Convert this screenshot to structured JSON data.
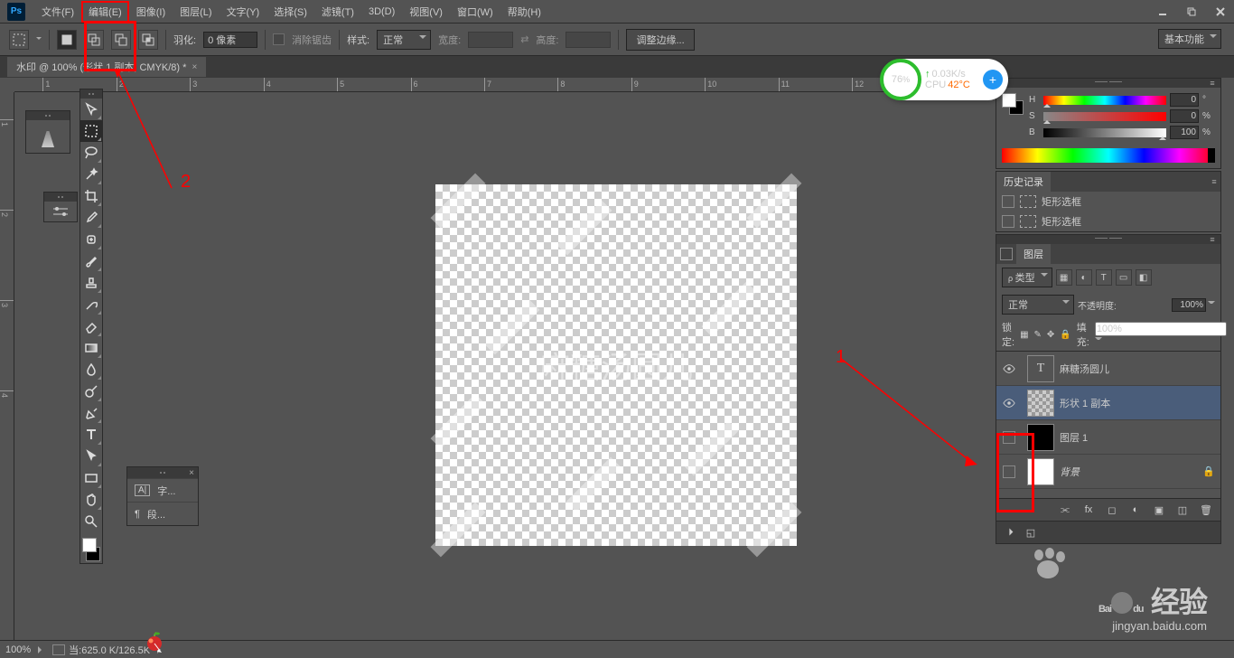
{
  "menu": {
    "items": [
      "文件(F)",
      "编辑(E)",
      "图像(I)",
      "图层(L)",
      "文字(Y)",
      "选择(S)",
      "滤镜(T)",
      "3D(D)",
      "视图(V)",
      "窗口(W)",
      "帮助(H)"
    ],
    "highlighted_index": 1
  },
  "optbar": {
    "feather_label": "羽化:",
    "feather_value": "0 像素",
    "antialias": "消除锯齿",
    "style_label": "样式:",
    "style_value": "正常",
    "width_label": "宽度:",
    "height_label": "高度:",
    "refine": "调整边缘...",
    "workspace": "基本功能"
  },
  "doc_tab": "水印 @ 100% (形状 1 副本, CMYK/8) *",
  "watermark_text": "麻糖汤圆儿",
  "annotations": {
    "num1": "1",
    "num2": "2"
  },
  "type_panel": {
    "char": "字...",
    "para": "段..."
  },
  "color_panel": {
    "h_label": "H",
    "s_label": "S",
    "b_label": "B",
    "h_val": "0",
    "s_val": "0",
    "b_val": "100",
    "deg_unit": "°",
    "pct_unit": "%"
  },
  "history": {
    "title": "历史记录",
    "items": [
      "矩形选框",
      "矩形选框"
    ]
  },
  "layers": {
    "tab": "图层",
    "type_label": "类型",
    "blend": "正常",
    "opacity_label": "不透明度:",
    "opacity": "100%",
    "lock_label": "锁定:",
    "fill_label": "填充:",
    "fill": "100%",
    "list": [
      {
        "name": "麻糖汤圆儿",
        "kind": "text",
        "visible": true
      },
      {
        "name": "形状 1 副本",
        "kind": "shape",
        "visible": true,
        "selected": true
      },
      {
        "name": "图层 1",
        "kind": "black",
        "visible": false
      },
      {
        "name": "背景",
        "kind": "white",
        "visible": false,
        "locked": true
      }
    ]
  },
  "statusbar": {
    "zoom": "100%",
    "info": ":625.0 K/126.5K"
  },
  "floater": {
    "percent": "76",
    "percent_unit": "%",
    "net": "0.03K/s",
    "cpu_label": "CPU",
    "cpu": "42°C"
  },
  "baidu": {
    "logo_en": "Bai",
    "logo_du": "du",
    "logo_cn": "经验",
    "url": "jingyan.baidu.com"
  }
}
